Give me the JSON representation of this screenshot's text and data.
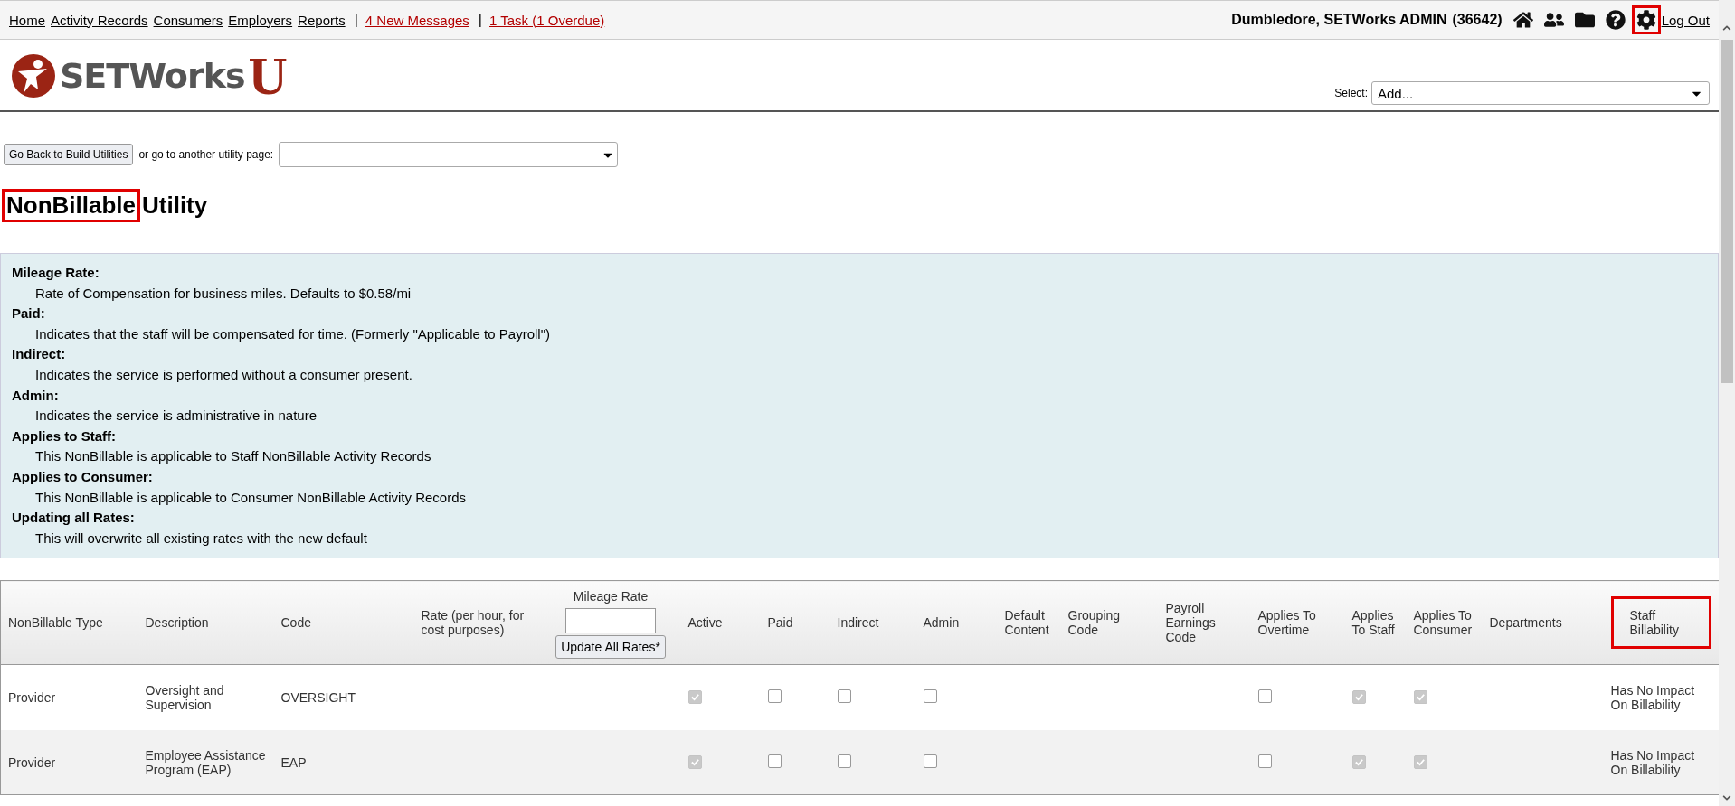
{
  "nav": {
    "links": [
      {
        "label": "Home",
        "kind": "plain"
      },
      {
        "label": "Activity Records",
        "kind": "plain"
      },
      {
        "label": "Consumers",
        "kind": "plain"
      },
      {
        "label": "Employers",
        "kind": "plain"
      },
      {
        "label": "Reports",
        "kind": "plain"
      },
      {
        "label": "|",
        "kind": "separator"
      },
      {
        "label": "4 New Messages",
        "kind": "alert"
      },
      {
        "label": "|",
        "kind": "separator"
      },
      {
        "label": "1 Task (1 Overdue)",
        "kind": "alert"
      }
    ],
    "user": "Dumbledore, SETWorks ADMIN",
    "user_id": "(36642)",
    "icons": [
      {
        "kind": "home",
        "highlighted": false
      },
      {
        "kind": "users",
        "highlighted": false
      },
      {
        "kind": "folder",
        "highlighted": false
      },
      {
        "kind": "help",
        "highlighted": false
      },
      {
        "kind": "settings",
        "highlighted": true
      }
    ],
    "logout": "Log Out"
  },
  "logo": {
    "name": "SETWorks",
    "letter": "U"
  },
  "select": {
    "label": "Select:",
    "value": "Add..."
  },
  "utility_bar": {
    "back_button": "Go Back to Build Utilities",
    "text": "or go to another utility page:"
  },
  "title": {
    "highlighted_word": "NonBillable",
    "rest": "Utility",
    "highlighted": true
  },
  "definitions": [
    {
      "term": "Mileage Rate:",
      "text": "Rate of Compensation for business miles. Defaults to $0.58/mi"
    },
    {
      "term": "Paid:",
      "text": "Indicates that the staff will be compensated for time. (Formerly \"Applicable to Payroll\")"
    },
    {
      "term": "Indirect:",
      "text": "Indicates the service is performed without a consumer present."
    },
    {
      "term": "Admin:",
      "text": "Indicates the service is administrative in nature"
    },
    {
      "term": "Applies to Staff:",
      "text": "This NonBillable is applicable to Staff NonBillable Activity Records"
    },
    {
      "term": "Applies to Consumer:",
      "text": "This NonBillable is applicable to Consumer NonBillable Activity Records"
    },
    {
      "term": "Updating all Rates:",
      "text": "This will overwrite all existing rates with the new default"
    }
  ],
  "table": {
    "columns": [
      {
        "label": "NonBillable Type",
        "kind": "text",
        "highlighted": false
      },
      {
        "label": "Description",
        "kind": "text",
        "highlighted": false
      },
      {
        "label": "Code",
        "kind": "text",
        "highlighted": false
      },
      {
        "label": "Rate (per hour, for cost purposes)",
        "kind": "text",
        "highlighted": false
      },
      {
        "label": "Mileage Rate",
        "kind": "mileage",
        "button": "Update All Rates*",
        "highlighted": false
      },
      {
        "label": "Active",
        "kind": "text",
        "highlighted": false
      },
      {
        "label": "Paid",
        "kind": "text",
        "highlighted": false
      },
      {
        "label": "Indirect",
        "kind": "text",
        "highlighted": false
      },
      {
        "label": "Admin",
        "kind": "text",
        "highlighted": false
      },
      {
        "label": "Default Content",
        "kind": "text",
        "highlighted": false
      },
      {
        "label": "Grouping Code",
        "kind": "text",
        "highlighted": false
      },
      {
        "label": "Payroll Earnings Code",
        "kind": "text",
        "highlighted": false
      },
      {
        "label": "Applies To Overtime",
        "kind": "text",
        "highlighted": false
      },
      {
        "label": "Applies To Staff",
        "kind": "text",
        "highlighted": false
      },
      {
        "label": "Applies To Consumer",
        "kind": "text",
        "highlighted": false
      },
      {
        "label": "Departments",
        "kind": "text",
        "highlighted": false
      },
      {
        "label": "Staff Billability",
        "kind": "text",
        "highlighted": true
      }
    ],
    "rows": [
      {
        "type": "Provider",
        "description": "Oversight and Supervision",
        "code": "OVERSIGHT",
        "active": true,
        "paid": false,
        "indirect": false,
        "admin": false,
        "overtime": false,
        "staff": true,
        "consumer": true,
        "billability": "Has No Impact On Billability"
      },
      {
        "type": "Provider",
        "description": "Employee Assistance Program (EAP)",
        "code": "EAP",
        "active": true,
        "paid": false,
        "indirect": false,
        "admin": false,
        "overtime": false,
        "staff": true,
        "consumer": true,
        "billability": "Has No Impact On Billability"
      }
    ]
  }
}
